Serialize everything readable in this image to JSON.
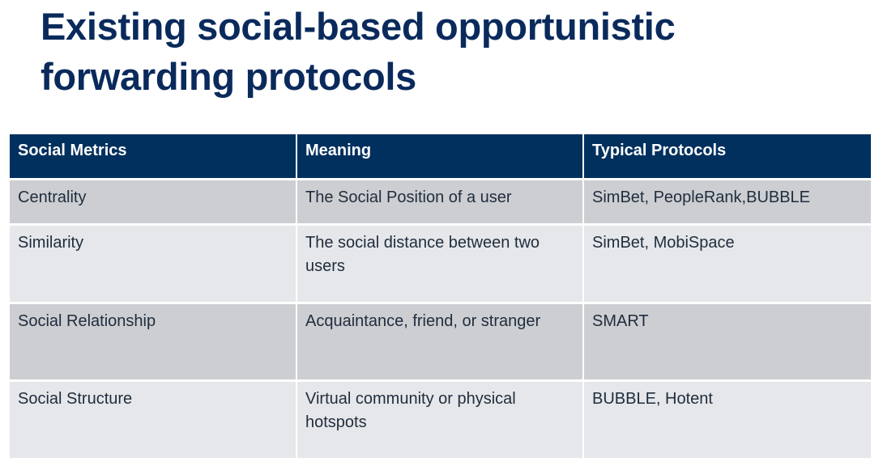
{
  "slide": {
    "title": "Existing social-based opportunistic forwarding protocols"
  },
  "table": {
    "headers": [
      "Social Metrics",
      "Meaning",
      "Typical Protocols"
    ],
    "rows": [
      [
        "Centrality",
        "The Social Position of a user",
        "SimBet, PeopleRank,BUBBLE"
      ],
      [
        "Similarity",
        "The social distance between two users",
        "SimBet, MobiSpace"
      ],
      [
        "Social Relationship",
        "Acquaintance, friend, or stranger",
        "SMART"
      ],
      [
        "Social Structure",
        "Virtual community or physical hotspots",
        "BUBBLE, Hotent"
      ]
    ]
  },
  "colors": {
    "title": "#0a2a5c",
    "header_bg": "#00305e",
    "row_dark": "#cdced2",
    "row_light": "#e6e7ea"
  }
}
